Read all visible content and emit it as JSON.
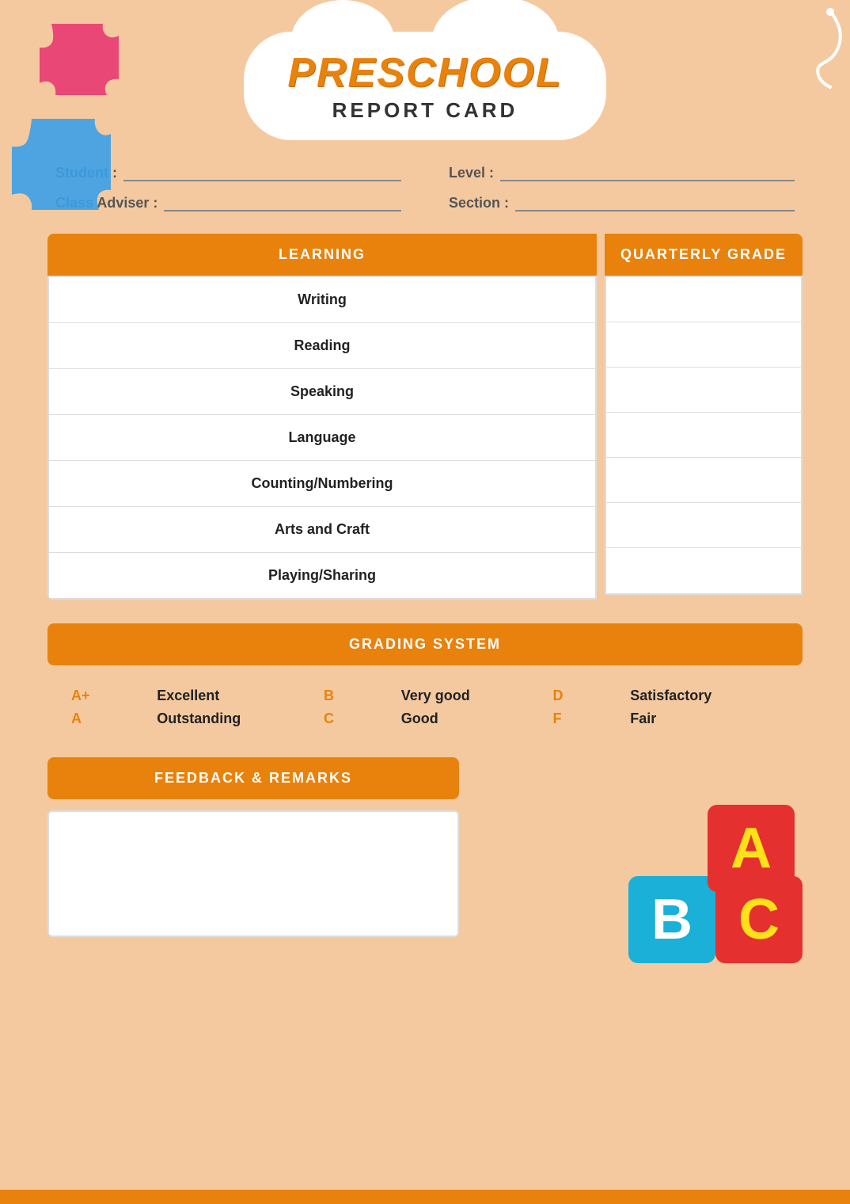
{
  "title": {
    "preschool": "PRESCHOOL",
    "report_card": "REPORT CARD"
  },
  "info": {
    "student_label": "Student :",
    "level_label": "Level :",
    "class_adviser_label": "Class Adviser :",
    "section_label": "Section :"
  },
  "table": {
    "learning_header": "LEARNING",
    "grade_header": "QUARTERLY GRADE",
    "subjects": [
      "Writing",
      "Reading",
      "Speaking",
      "Language",
      "Counting/Numbering",
      "Arts and Craft",
      "Playing/Sharing"
    ]
  },
  "grading": {
    "header": "GRADING SYSTEM",
    "items": [
      {
        "letter": "A+",
        "desc": "Excellent"
      },
      {
        "letter": "B",
        "desc": "Very good"
      },
      {
        "letter": "D",
        "desc": "Satisfactory"
      },
      {
        "letter": "A",
        "desc": "Outstanding"
      },
      {
        "letter": "C",
        "desc": "Good"
      },
      {
        "letter": "F",
        "desc": "Fair"
      }
    ]
  },
  "feedback": {
    "header": "FEEDBACK & REMARKS"
  },
  "blocks": {
    "a": "A",
    "b": "B",
    "c": "C"
  },
  "colors": {
    "orange": "#E8820C",
    "background": "#F5C9A0"
  }
}
